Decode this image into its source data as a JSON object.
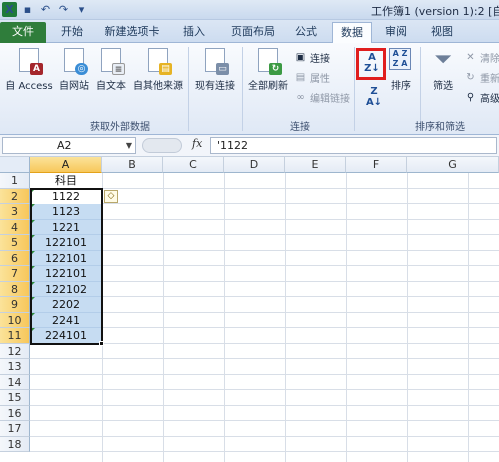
{
  "window": {
    "title": "工作簿1 (version 1):2 [自动"
  },
  "qat": {
    "icons": [
      "excel-logo-icon",
      "save-icon",
      "undo-icon",
      "redo-icon",
      "customize-icon"
    ]
  },
  "tabs": [
    {
      "label": "文件"
    },
    {
      "label": "开始"
    },
    {
      "label": "新建选项卡"
    },
    {
      "label": "插入"
    },
    {
      "label": "页面布局"
    },
    {
      "label": "公式"
    },
    {
      "label": "数据"
    },
    {
      "label": "审阅"
    },
    {
      "label": "视图"
    }
  ],
  "ribbon": {
    "external": {
      "group_label": "获取外部数据",
      "buttons": [
        {
          "label": "自 Access"
        },
        {
          "label": "自网站"
        },
        {
          "label": "自文本"
        },
        {
          "label": "自其他来源"
        },
        {
          "label": "现有连接"
        }
      ]
    },
    "connections": {
      "group_label": "连接",
      "refresh_label": "全部刷新",
      "links": [
        {
          "label": "连接"
        },
        {
          "label": "属性"
        },
        {
          "label": "编辑链接"
        }
      ]
    },
    "sort": {
      "group_label": "排序和筛选",
      "sort_az": "A→Z",
      "sort_za": "Z→A",
      "sort_label": "排序",
      "filter_label": "筛选",
      "clear_label": "清除",
      "reapply_label": "重新",
      "advanced_label": "高级"
    }
  },
  "formula_bar": {
    "name_box": "A2",
    "fx": "fx",
    "content": "'1122"
  },
  "sheet": {
    "columns": [
      "A",
      "B",
      "C",
      "D",
      "E",
      "F",
      "G"
    ],
    "rows": [
      "1",
      "2",
      "3",
      "4",
      "5",
      "6",
      "7",
      "8",
      "9",
      "10",
      "11",
      "12",
      "13",
      "14",
      "15",
      "16",
      "17",
      "18"
    ],
    "column_a": [
      "科目",
      "1122",
      "1123",
      "1221",
      "122101",
      "122101",
      "122101",
      "122102",
      "2202",
      "2241",
      "224101"
    ],
    "selected_range": "A2:A11",
    "active_cell": "A2"
  }
}
